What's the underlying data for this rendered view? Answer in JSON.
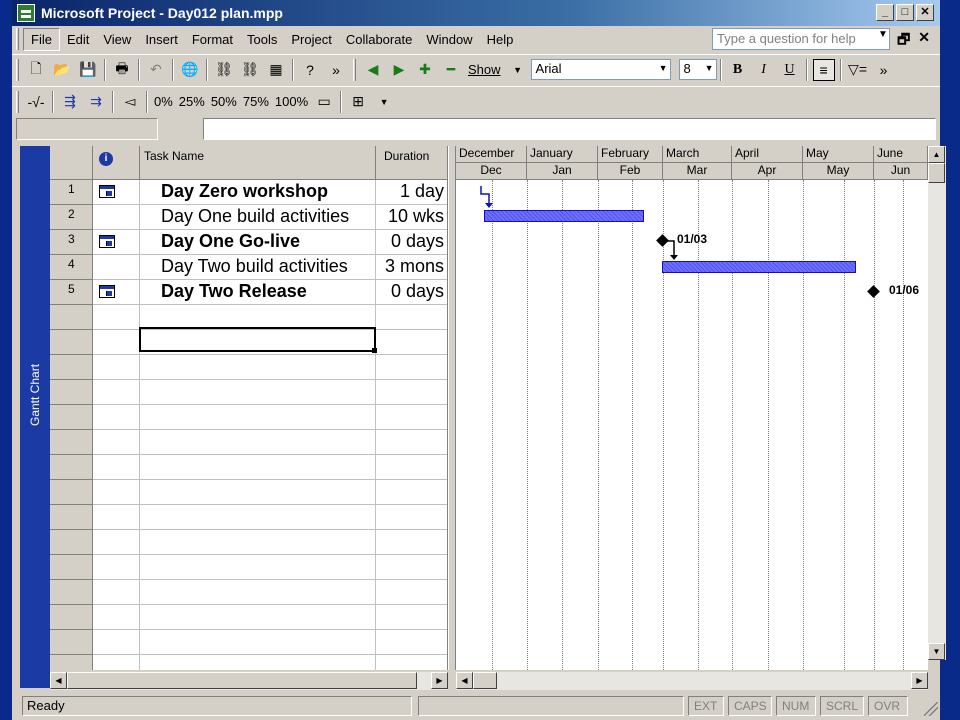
{
  "window": {
    "title": "Microsoft Project - Day012 plan.mpp"
  },
  "menubar": {
    "items": [
      "File",
      "Edit",
      "View",
      "Insert",
      "Format",
      "Tools",
      "Project",
      "Collaborate",
      "Window",
      "Help"
    ],
    "question_placeholder": "Type a question for help"
  },
  "toolbar": {
    "show_label": "Show",
    "font_name": "Arial",
    "font_size": "8",
    "percent_buttons": [
      "0%",
      "25%",
      "50%",
      "75%",
      "100%"
    ]
  },
  "viewbar": {
    "label": "Gantt Chart"
  },
  "sheet": {
    "columns": {
      "task_name": "Task Name",
      "duration": "Duration"
    },
    "tasks": [
      {
        "id": "1",
        "name": "Day Zero workshop",
        "duration": "1 day",
        "bold": true,
        "has_note": true
      },
      {
        "id": "2",
        "name": "Day One build activities",
        "duration": "10 wks",
        "bold": false,
        "has_note": false
      },
      {
        "id": "3",
        "name": "Day One Go-live",
        "duration": "0 days",
        "bold": true,
        "has_note": true
      },
      {
        "id": "4",
        "name": "Day Two build activities",
        "duration": "3 mons",
        "bold": false,
        "has_note": false
      },
      {
        "id": "5",
        "name": "Day Two Release",
        "duration": "0 days",
        "bold": true,
        "has_note": true
      }
    ]
  },
  "gantt": {
    "top_tier": [
      "December",
      "January",
      "February",
      "March",
      "April",
      "May",
      "June"
    ],
    "bottom_tier": [
      "Dec",
      "Jan",
      "Feb",
      "Mar",
      "Apr",
      "May",
      "Jun"
    ],
    "milestones": [
      {
        "task": "3",
        "label": "01/03"
      },
      {
        "task": "5",
        "label": "01/06"
      }
    ],
    "bar_color": "#6060f8"
  },
  "statusbar": {
    "ready": "Ready",
    "indicators": [
      "EXT",
      "CAPS",
      "NUM",
      "SCRL",
      "OVR"
    ]
  }
}
